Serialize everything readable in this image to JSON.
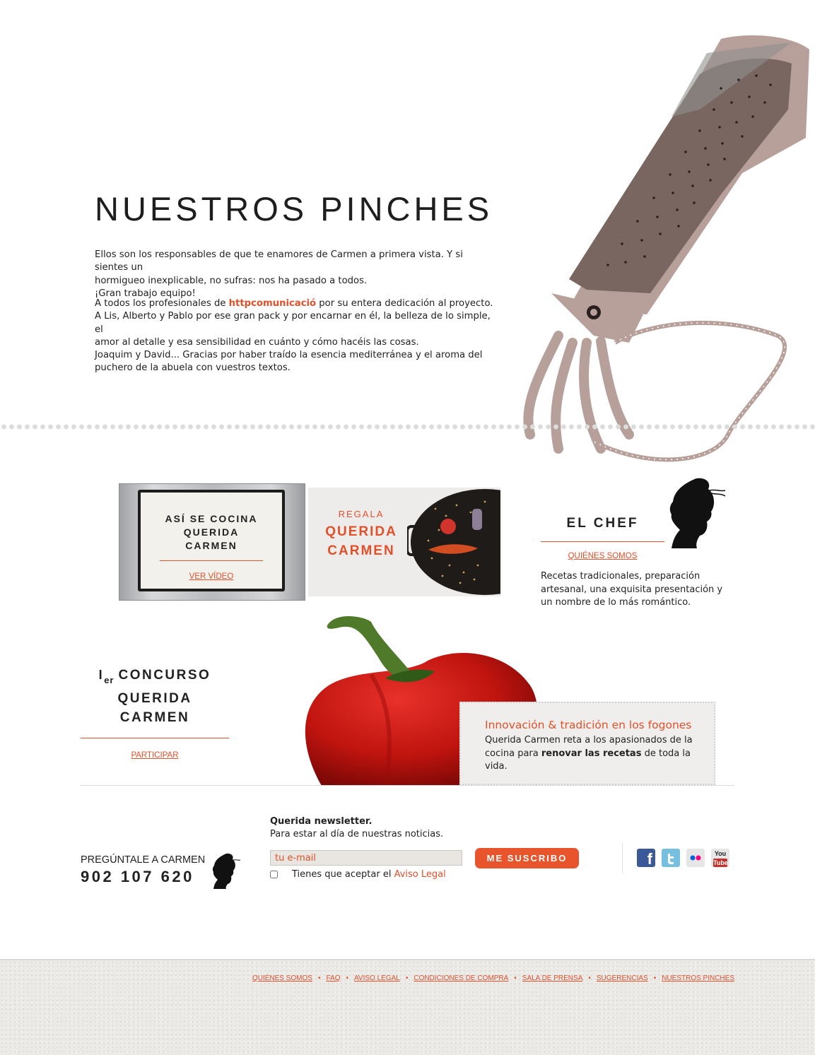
{
  "colors": {
    "accent": "#e2502a",
    "text": "#222222",
    "footer_bg": "#eceae7"
  },
  "hero": {
    "title": "NUESTROS PINCHES",
    "p1_l1": "Ellos son los responsables de que te enamores de Carmen a primera vista. Y si sientes un",
    "p1_l2": "hormigueo inexplicable, no sufras: nos ha pasado a todos.",
    "p1_l3": "¡Gran trabajo equipo!",
    "p2_pre": "A todos los profesionales de ",
    "p2_link": "httpcomunicació",
    "p2_post": " por su entera dedicación al proyecto.",
    "p3_l1": "A Lis, Alberto y Pablo por ese gran pack y por encarnar en él, la belleza de lo simple, el",
    "p3_l2": "amor al detalle y esa sensibilidad en cuánto y cómo hacéis las cosas.",
    "p3_l3": "Joaquim y David... Gracias por haber traído la esencia mediterránea y el aroma del",
    "p3_l4": "puchero de la abuela con vuestros textos."
  },
  "video_block": {
    "line1": "ASÍ SE COCINA",
    "line2": "QUERIDA",
    "line3": "CARMEN",
    "link": "VER VÍDEO"
  },
  "gift_block": {
    "small": "REGALA",
    "big1": "QUERIDA",
    "big2": "CARMEN"
  },
  "chef_block": {
    "title": "EL CHEF",
    "link": "QUIÉNES SOMOS",
    "desc_l1": "Recetas tradicionales, preparación",
    "desc_l2": "artesanal, una exquisita presentación y",
    "desc_l3": "un nombre de lo más romántico."
  },
  "contest_block": {
    "ordinal": "I",
    "ordinal_sup": "er",
    "word": "CONCURSO",
    "line2": "QUERIDA",
    "line3": "CARMEN",
    "link": "PARTICIPAR"
  },
  "ticket": {
    "title": "Innovación & tradición en los fogones",
    "l1": "Querida Carmen reta a los apasionados de la",
    "l2_pre": "cocina para ",
    "l2_bold": "renovar las recetas",
    "l2_post": " de toda la",
    "l3": "vida."
  },
  "contact": {
    "label": "PREGÚNTALE A CARMEN",
    "phone": "902 107 620"
  },
  "newsletter": {
    "title": "Querida newsletter.",
    "subtitle": "Para estar al día de nuestras noticias.",
    "placeholder": "tu e-mail",
    "accept_pre": "Tienes que aceptar el ",
    "accept_link": "Aviso Legal",
    "button": "ME SUSCRIBO"
  },
  "social": {
    "facebook": "f",
    "youtube_1": "You",
    "youtube_2": "Tube"
  },
  "footer": {
    "links": [
      "QUIÉNES SOMOS",
      "FAQ",
      "AVISO LEGAL",
      "CONDICIONES DE COMPRA",
      "SALA DE PRENSA",
      "SUGERENCIAS",
      "NUESTROS PINCHES"
    ],
    "separator": "•"
  }
}
